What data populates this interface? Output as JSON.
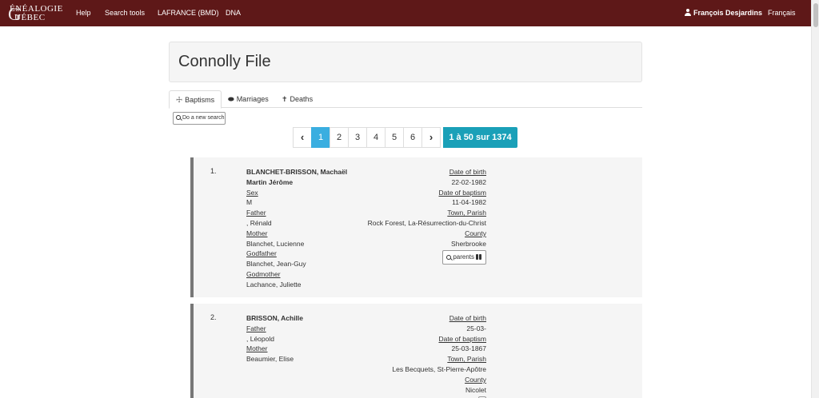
{
  "nav": {
    "brand_line1": "ÉNÉALOGIE",
    "brand_line2": "UÉBEC",
    "brand_initials": "GQ",
    "links": [
      "Help",
      "Search tools",
      "LAFRANCE (BMD)",
      "DNA"
    ],
    "user": "François Desjardins",
    "language": "Français"
  },
  "page": {
    "title": "Connolly File"
  },
  "tabs": [
    {
      "label": "Baptisms",
      "icon": "cross-icon",
      "active": true
    },
    {
      "label": "Marriages",
      "icon": "rings-icon",
      "active": false
    },
    {
      "label": "Deaths",
      "icon": "cross-icon",
      "active": false
    }
  ],
  "new_search_label": "Do a new search",
  "pagination": {
    "prev": "‹",
    "pages": [
      "1",
      "2",
      "3",
      "4",
      "5",
      "6"
    ],
    "current": "1",
    "next": "›",
    "count_label": "1 à 50 sur 1374"
  },
  "records": [
    {
      "num": "1.",
      "name_line1": "BLANCHET-BRISSON, Machaël",
      "name_line2": "Martin Jérôme",
      "sex_label": "Sex",
      "sex": "M",
      "father_label": "Father",
      "father": ", Rénald",
      "mother_label": "Mother",
      "mother": "Blanchet, Lucienne",
      "godfather_label": "Godfather",
      "godfather": "Blanchet, Jean-Guy",
      "godmother_label": "Godmother",
      "godmother": "Lachance, Juliette",
      "dob_label": "Date of birth",
      "dob": "22-02-1982",
      "dobap_label": "Date of baptism",
      "dobap": "11-04-1982",
      "town_label": "Town, Parish",
      "town": "Rock Forest, La-Résurrection-du-Christ",
      "county_label": "County",
      "county": "Sherbrooke",
      "parents_btn": "parents"
    },
    {
      "num": "2.",
      "name_line1": "BRISSON, Achille",
      "father_label": "Father",
      "father": ", Léopold",
      "mother_label": "Mother",
      "mother": "Beaumier, Elise",
      "dob_label": "Date of birth",
      "dob": "25-03-",
      "dobap_label": "Date of baptism",
      "dobap": "25-03-1867",
      "town_label": "Town, Parish",
      "town": "Les Becquets, St-Pierre-Apôtre",
      "county_label": "County",
      "county": "Nicolet"
    }
  ]
}
